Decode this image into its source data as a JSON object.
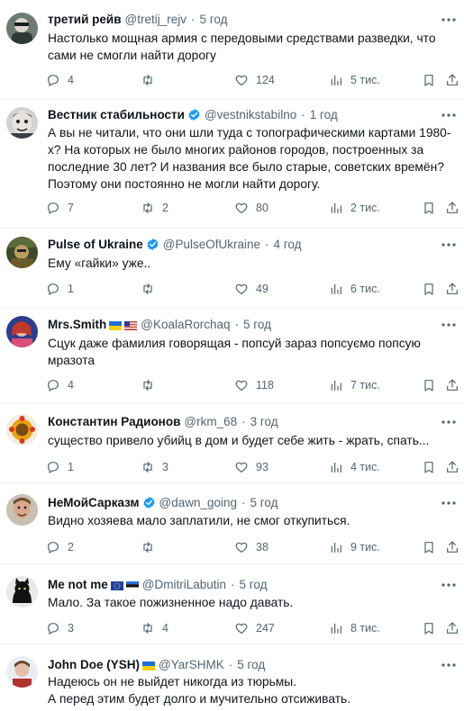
{
  "tweets": [
    {
      "name": "третий рейв",
      "handle": "@tretij_rejv",
      "time": "5 год",
      "lines": [
        "Настолько мощная армия с передовыми средствами разведки, что",
        "сами не смогли найти дорогу"
      ],
      "replies": "4",
      "reposts": "",
      "likes": "124",
      "views": "5 тис.",
      "verified": false,
      "flags": []
    },
    {
      "name": "Вестник стабильности",
      "handle": "@vestnikstabilno",
      "time": "1 год",
      "lines": [
        "А вы не читали, что они шли туда с топографическими картами 1980-",
        "х? На которых не было многих районов городов, построенных за",
        "последние 30 лет? И названия все было старые, советских времён?",
        "Поэтому они постоянно не могли найти дорогу."
      ],
      "replies": "7",
      "reposts": "2",
      "likes": "80",
      "views": "2 тис.",
      "verified": true,
      "flags": []
    },
    {
      "name": "Pulse of Ukraine",
      "handle": "@PulseOfUkraine",
      "time": "4 год",
      "lines": [
        "Ему «гайки» уже.."
      ],
      "replies": "1",
      "reposts": "",
      "likes": "49",
      "views": "6 тис.",
      "verified": true,
      "flags": []
    },
    {
      "name": "Mrs.Smith",
      "handle": "@KoalaRorchaq",
      "time": "5 год",
      "lines": [
        "Сцук даже фамилия говорящая - попсуй зараз попсуємо попсую",
        "мразота"
      ],
      "replies": "4",
      "reposts": "",
      "likes": "118",
      "views": "7 тис.",
      "verified": false,
      "flags": [
        "ua",
        "us"
      ]
    },
    {
      "name": "Константин Радионов",
      "handle": "@rkm_68",
      "time": "3 год",
      "lines": [
        "существо привело убийц в дом и будет себе жить - жрать, спать..."
      ],
      "replies": "1",
      "reposts": "3",
      "likes": "93",
      "views": "4 тис.",
      "verified": false,
      "flags": []
    },
    {
      "name": "НеМойСарказм",
      "handle": "@dawn_going",
      "time": "5 год",
      "lines": [
        "Видно хозяева мало заплатили, не смог откупиться."
      ],
      "replies": "2",
      "reposts": "",
      "likes": "38",
      "views": "9 тис.",
      "verified": true,
      "flags": []
    },
    {
      "name": "Me not me",
      "handle": "@DmitriLabutin",
      "time": "5 год",
      "lines": [
        "Мало. За такое пожизненное надо давать."
      ],
      "replies": "3",
      "reposts": "4",
      "likes": "247",
      "views": "8 тис.",
      "verified": false,
      "flags": [
        "eu",
        "ee"
      ]
    },
    {
      "name": "John Doe (YSH)",
      "handle": "@YarSHMK",
      "time": "5 год",
      "lines": [
        "Надеюсь он не выйдет никогда из тюрьмы.",
        "А перед этим будет долго и мучительно отсиживать."
      ],
      "replies": "",
      "reposts": "",
      "likes": "",
      "views": "",
      "verified": false,
      "flags": [
        "ua"
      ]
    }
  ],
  "colors": {
    "text": "#0f1419",
    "secondary": "#536471",
    "verified": "#1d9bf0",
    "divider": "#eff3f4"
  },
  "icons": [
    "reply-icon",
    "repost-icon",
    "like-icon",
    "views-icon",
    "bookmark-icon",
    "share-icon",
    "more-icon",
    "verified-icon"
  ]
}
